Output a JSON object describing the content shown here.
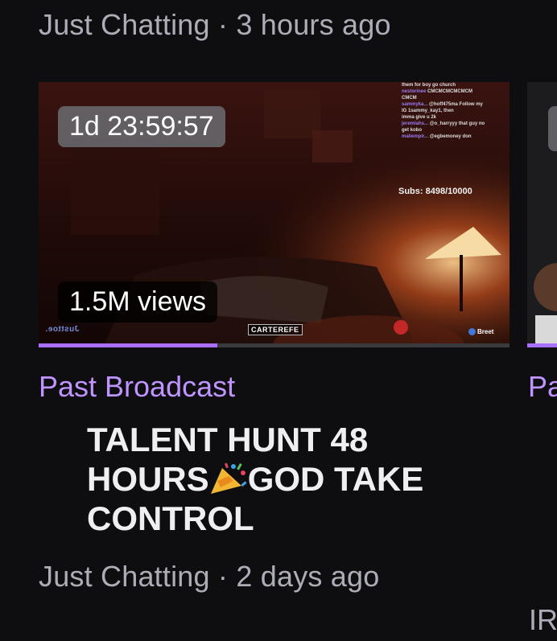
{
  "top_meta": {
    "category": "Just Chatting",
    "separator": "·",
    "age": "3 hours ago"
  },
  "card": {
    "duration": "1d 23:59:57",
    "views": "1.5M views",
    "progress": 0.38,
    "overlay": {
      "subs": "Subs: 8498/10000",
      "watermark_left": "Justtoe.",
      "watermark_center": "CARTEREFE",
      "watermark_right": "Breet",
      "chat": [
        {
          "name": "",
          "text": "them for boy go church"
        },
        {
          "name": "nestorinee",
          "text": "CMCMCMCMCMCM"
        },
        {
          "name": "",
          "text": "CMCM"
        },
        {
          "name": "sammyka...",
          "text": "@hoff475ma Follow my"
        },
        {
          "name": "",
          "text": "IG 1sammy_kay1, then"
        },
        {
          "name": "",
          "text": "imma give u 2k"
        },
        {
          "name": "jeremiahs...",
          "text": "@o_harryyy that guy no"
        },
        {
          "name": "",
          "text": "get kobo"
        },
        {
          "name": "maliempir...",
          "text": "@egbemoney don"
        }
      ]
    },
    "type_label": "Past Broadcast",
    "title_part1": "TALENT HUNT 48 HOURS",
    "title_emoji": "party-popper-icon",
    "title_part2": "GOD TAKE CONTROL",
    "meta": {
      "category": "Just Chatting",
      "separator": "·",
      "age": "2 days ago"
    }
  },
  "next_card": {
    "type_label_partial": "Pa",
    "meta_partial": "IR"
  },
  "colors": {
    "background": "#0e0e10",
    "accent": "#bf94ff",
    "progress": "#a970ff",
    "meta": "#adadb8"
  }
}
